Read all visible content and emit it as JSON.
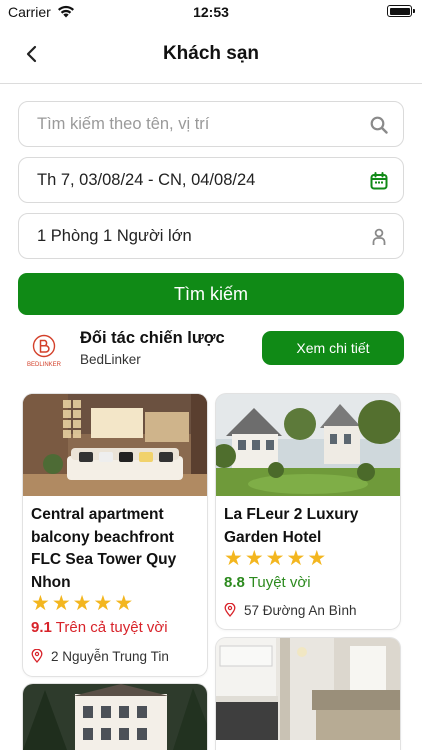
{
  "status_bar": {
    "carrier": "Carrier",
    "time": "12:53"
  },
  "nav": {
    "title": "Khách sạn"
  },
  "search": {
    "placeholder": "Tìm kiếm theo tên, vị trí",
    "dates": "Th 7, 03/08/24 - CN, 04/08/24",
    "guests": "1 Phòng 1 Người lớn",
    "button": "Tìm kiếm"
  },
  "partner": {
    "logo_text": "BEDLINKER",
    "title": "Đối tác chiến lược",
    "name": "BedLinker",
    "button": "Xem chi tiết"
  },
  "hotels": [
    {
      "name": "Central apartment balcony beachfront FLC Sea Tower Quy Nhon",
      "stars": 5,
      "score": "9.1",
      "rating_text": "Trên cả tuyệt vời",
      "address": "2 Nguyễn Trung Tin"
    },
    {
      "name": "La FLeur 2 Luxury Garden Hotel",
      "stars": 5,
      "score": "8.8",
      "rating_text": "Tuyệt vời",
      "address": "57 Đường An Bình"
    }
  ],
  "colors": {
    "primary": "#108a16",
    "star": "#f3b61f",
    "rating_excellent": "#d8232a",
    "rating_great": "#2c8a1e"
  }
}
